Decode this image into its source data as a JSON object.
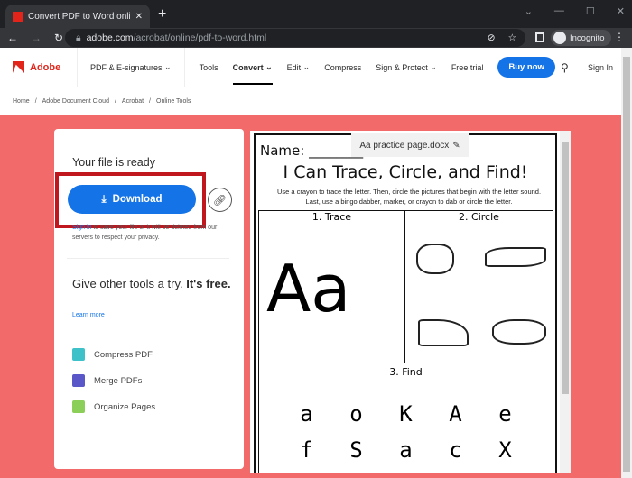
{
  "browser": {
    "tab_title": "Convert PDF to Word online for f",
    "url_domain": "adobe.com",
    "url_path": "/acrobat/online/pdf-to-word.html",
    "profile": "Incognito"
  },
  "nav": {
    "brand": "Adobe",
    "pdf_esign": "PDF & E-signatures",
    "items": [
      "Tools",
      "Convert",
      "Edit",
      "Compress",
      "Sign & Protect",
      "Free trial"
    ],
    "buy": "Buy now",
    "signin": "Sign In"
  },
  "breadcrumb": [
    "Home",
    "Adobe Document Cloud",
    "Acrobat",
    "Online Tools"
  ],
  "panel": {
    "ready": "Your file is ready",
    "download": "Download",
    "signin_link": "Sign in",
    "note": " to save your file or it will be deleted from our servers to respect your privacy.",
    "give": "Give other tools a try.",
    "free": "It's free.",
    "learn": "Learn more",
    "tools": [
      "Compress PDF",
      "Merge PDFs",
      "Organize Pages"
    ]
  },
  "doc": {
    "filename": "Aa practice page.docx",
    "name_label": "Name: ________",
    "title": "I Can Trace, Circle, and Find!",
    "instructions": "Use a crayon to trace the letter. Then, circle the pictures that begin with the letter sound. Last, use a bingo dabber, marker, or crayon to dab or circle the letter.",
    "trace": "1. Trace",
    "circle": "2. Circle",
    "find": "3. Find",
    "big": "Aa",
    "row1": [
      "a",
      "o",
      "K",
      "A",
      "e"
    ],
    "row2": [
      "f",
      "S",
      "a",
      "c",
      "X"
    ]
  }
}
